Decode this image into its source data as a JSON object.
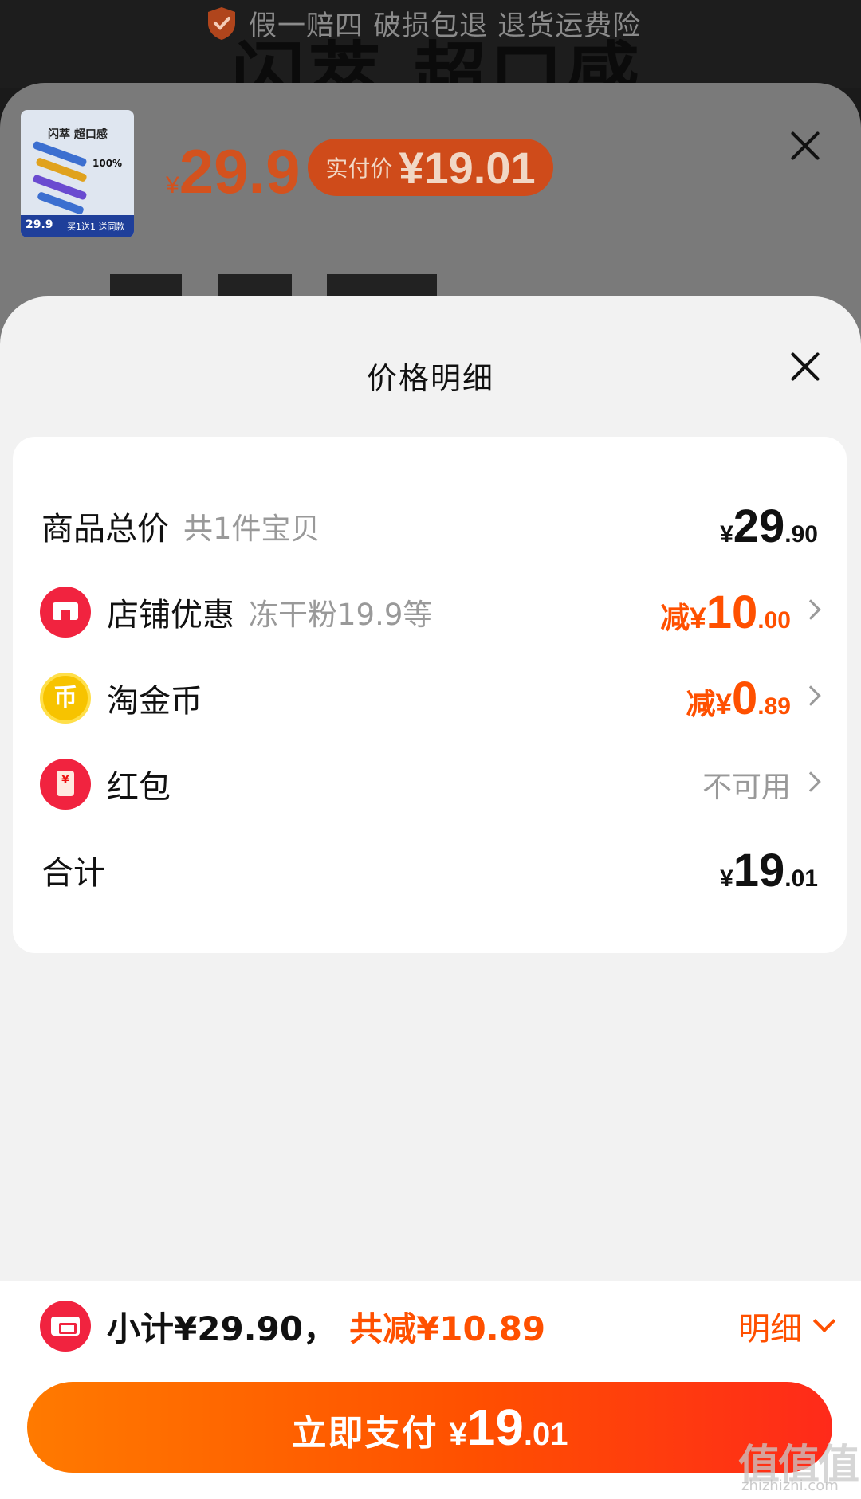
{
  "banner": {
    "guarantee_text": "假一赔四 破损包退 退货运费险",
    "bg_title": "闪萃 超口感"
  },
  "product": {
    "thumb_title": "闪萃 超口感",
    "thumb_percent": "100%",
    "thumb_price": "29.9",
    "thumb_promo": "买1送1 送同款",
    "price_symbol": "¥",
    "price": "29.9",
    "actual_label": "实付价",
    "actual_price": "¥19.01"
  },
  "sheet": {
    "title": "价格明细"
  },
  "rows": {
    "total": {
      "label": "商品总价",
      "sub": "共1件宝贝",
      "yen": "¥",
      "int": "29",
      "dec": ".90"
    },
    "shop": {
      "label": "店铺优惠",
      "sub": "冻干粉19.9等",
      "prefix": "减¥",
      "int": "10",
      "dec": ".00"
    },
    "coin": {
      "label": "淘金币",
      "icon_glyph": "币",
      "prefix": "减¥",
      "int": "0",
      "dec": ".89"
    },
    "redpacket": {
      "label": "红包",
      "icon_glyph": "¥",
      "status": "不可用"
    },
    "sum": {
      "label": "合计",
      "yen": "¥",
      "int": "19",
      "dec": ".01"
    }
  },
  "footer": {
    "subtotal": "小计¥29.90，",
    "discount": "共减¥10.89",
    "detail_label": "明细",
    "pay_label": "立即支付",
    "pay_yen": "¥",
    "pay_int": "19",
    "pay_dec": ".01"
  },
  "watermark": {
    "text": "值值值",
    "sub": "zhizhizhi.com"
  },
  "colors": {
    "accent": "#ff5000",
    "red_icon": "#f1233f",
    "coin": "#f7c300",
    "sheet_bg": "#f2f2f2"
  }
}
